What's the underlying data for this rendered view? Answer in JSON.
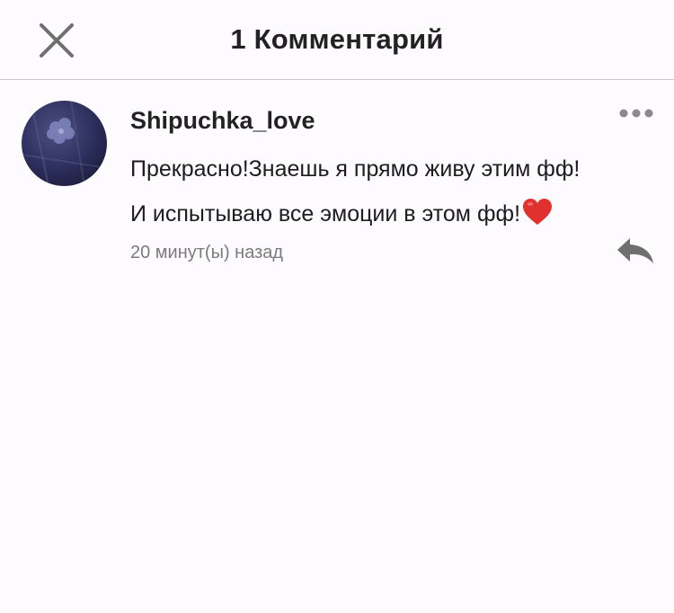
{
  "header": {
    "title": "1 Комментарий",
    "close_icon": "close-icon"
  },
  "comment": {
    "username": "Shipuchka_love",
    "text_line1": "Прекрасно!Знаешь я прямо живу этим фф!",
    "text_line2": "И испытываю все эмоции в этом фф!",
    "emoji": "heart-emoji",
    "timestamp": "20 минут(ы) назад",
    "more_icon": "more-dots-icon",
    "reply_icon": "reply-arrow-icon"
  },
  "colors": {
    "background": "#fdfbfd",
    "divider": "#c9c9c9",
    "secondary_text": "#7b7b7b",
    "icon_gray": "#6f6f6f",
    "heart": "#e0312f"
  }
}
